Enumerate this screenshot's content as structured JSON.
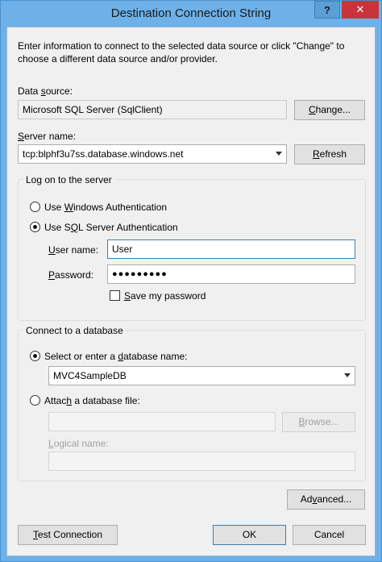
{
  "window": {
    "title": "Destination Connection String",
    "help_glyph": "?",
    "close_glyph": "✕"
  },
  "intro_text": "Enter information to connect to the selected data source or click \"Change\" to choose a different data source and/or provider.",
  "data_source": {
    "label_pre": "Data ",
    "label_key": "s",
    "label_post": "ource:",
    "value": "Microsoft SQL Server (SqlClient)",
    "change_pre": "",
    "change_key": "C",
    "change_post": "hange..."
  },
  "server": {
    "label_pre": "",
    "label_key": "S",
    "label_post": "erver name:",
    "value": "tcp:blphf3u7ss.database.windows.net",
    "refresh_pre": "",
    "refresh_key": "R",
    "refresh_post": "efresh"
  },
  "logon": {
    "group_title": "Log on to the server",
    "windows_auth_pre": "Use ",
    "windows_auth_key": "W",
    "windows_auth_post": "indows Authentication",
    "sql_auth_pre": "Use S",
    "sql_auth_key": "Q",
    "sql_auth_post": "L Server Authentication",
    "selected": "sql",
    "username_pre": "",
    "username_key": "U",
    "username_post": "ser name:",
    "username_value": "User",
    "password_pre": "",
    "password_key": "P",
    "password_post": "assword:",
    "password_value": "●●●●●●●●●",
    "save_pre": "",
    "save_key": "S",
    "save_post": "ave my password",
    "save_checked": false
  },
  "database": {
    "group_title": "Connect to a database",
    "select_pre": "Select or enter a ",
    "select_key": "d",
    "select_post": "atabase name:",
    "db_value": "MVC4SampleDB",
    "attach_pre": "Attac",
    "attach_key": "h",
    "attach_post": " a database file:",
    "browse_pre": "",
    "browse_key": "B",
    "browse_post": "rowse...",
    "logical_pre": "",
    "logical_key": "L",
    "logical_post": "ogical name:",
    "selected": "select"
  },
  "buttons": {
    "advanced_pre": "Ad",
    "advanced_key": "v",
    "advanced_post": "anced...",
    "test_pre": "",
    "test_key": "T",
    "test_post": "est Connection",
    "ok": "OK",
    "cancel": "Cancel"
  }
}
